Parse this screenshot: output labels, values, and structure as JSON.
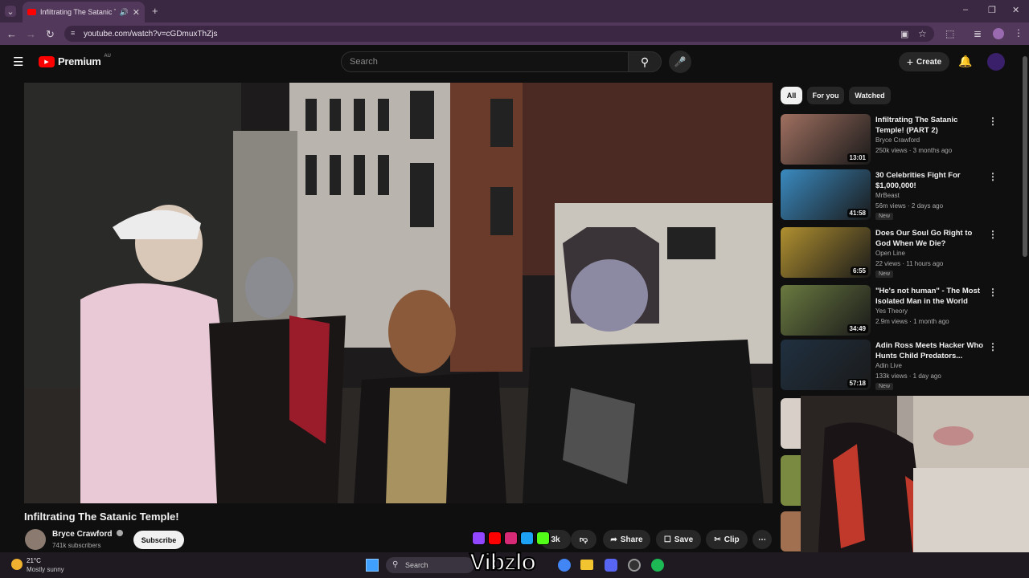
{
  "browser": {
    "tab_title": "Infiltrating The Satanic Temp",
    "new_tab_symbol": "+",
    "url": "youtube.com/watch?v=cGDmuxThZjs"
  },
  "header": {
    "logo_text": "Premium",
    "region": "AU",
    "search_placeholder": "Search",
    "create_label": "Create"
  },
  "chips": [
    "All",
    "For you",
    "Watched"
  ],
  "video": {
    "title": "Infiltrating The Satanic Temple!",
    "channel": "Bryce Crawford",
    "subscribers": "741k subscribers",
    "subscribe_label": "Subscribe",
    "likes": "3k",
    "share_label": "Share",
    "save_label": "Save",
    "clip_label": "Clip"
  },
  "suggestions": [
    {
      "title": "Infiltrating The Satanic Temple! (PART 2)",
      "channel": "Bryce Crawford",
      "meta": "250k views · 3 months ago",
      "duration": "13:01",
      "new": "",
      "thumb_color": "#a07060"
    },
    {
      "title": "30 Celebrities Fight For $1,000,000!",
      "channel": "MrBeast",
      "meta": "56m views · 2 days ago",
      "duration": "41:58",
      "new": "New",
      "thumb_color": "#3a8ac0"
    },
    {
      "title": "Does Our Soul Go Right to God When We Die?",
      "channel": "Open Line",
      "meta": "22 views · 11 hours ago",
      "duration": "6:55",
      "new": "New",
      "thumb_color": "#b09030"
    },
    {
      "title": "\"He's not human\" - The Most Isolated Man in the World",
      "channel": "Yes Theory",
      "meta": "2.9m views · 1 month ago",
      "duration": "34:49",
      "new": "",
      "thumb_color": "#6a7a40"
    },
    {
      "title": "Adin Ross Meets Hacker Who Hunts Child Predators...",
      "channel": "Adin Live",
      "meta": "133k views · 1 day ago",
      "duration": "57:18",
      "new": "New",
      "thumb_color": "#203040"
    }
  ],
  "taskbar": {
    "temp": "21°C",
    "weather": "Mostly sunny",
    "search_label": "Search"
  },
  "overlay": {
    "watermark": "Vibzlo"
  },
  "colors": {
    "accent": "#ff0000",
    "chrome_frame": "#3a2741"
  }
}
